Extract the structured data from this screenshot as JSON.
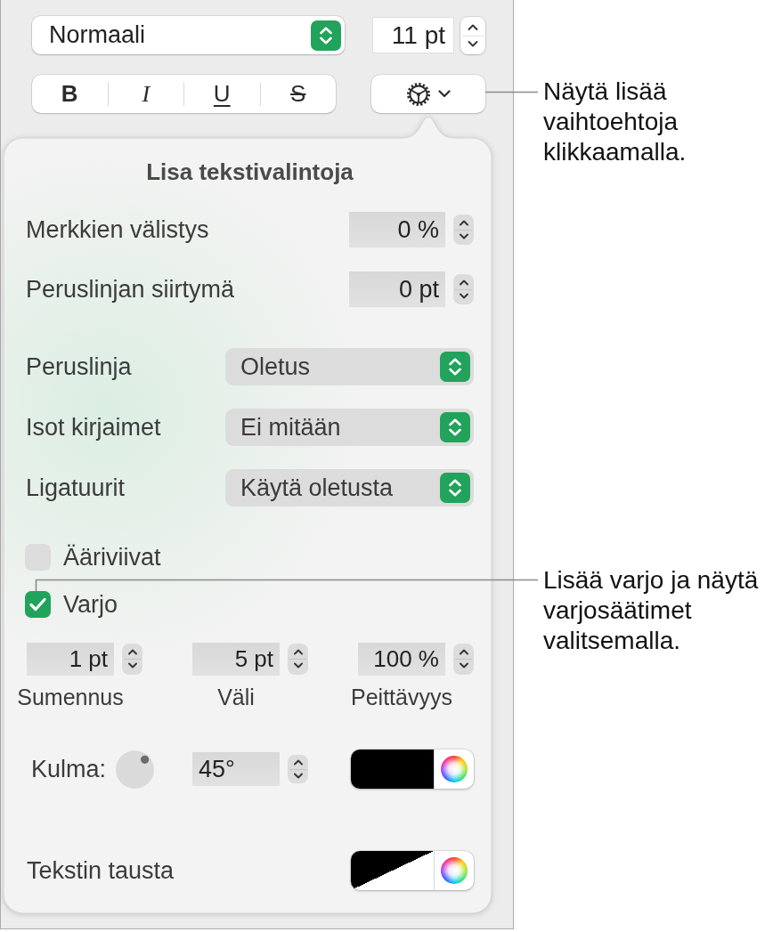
{
  "toolbar": {
    "paragraph_style": "Normaali",
    "font_size": "11 pt",
    "style_buttons": [
      {
        "label": "B",
        "kind": "bold",
        "on": false
      },
      {
        "label": "I",
        "kind": "italic",
        "on": false
      },
      {
        "label": "U",
        "kind": "underline",
        "on": false
      },
      {
        "label": "S",
        "kind": "strikethrough",
        "on": false
      }
    ]
  },
  "popover": {
    "title": "Lisa tekstivalintoja",
    "number_rows": [
      {
        "label": "Merkkien välistys",
        "value": "0 %"
      },
      {
        "label": "Peruslinjan siirtymä",
        "value": "0 pt"
      }
    ],
    "popup_rows": [
      {
        "label": "Peruslinja",
        "value": "Oletus"
      },
      {
        "label": "Isot kirjaimet",
        "value": "Ei mitään"
      },
      {
        "label": "Ligatuurit",
        "value": "Käytä oletusta"
      }
    ],
    "checkboxes": [
      {
        "label": "Ääriviivat",
        "checked": false
      },
      {
        "label": "Varjo",
        "checked": true
      }
    ],
    "shadow_fields": [
      {
        "value": "1 pt",
        "label": "Sumennus"
      },
      {
        "value": "5 pt",
        "label": "Väli"
      },
      {
        "value": "100 %",
        "label": "Peittävyys"
      }
    ],
    "angle": {
      "label": "Kulma:",
      "value": "45°"
    },
    "shadow_color": {
      "kind": "solid",
      "color": "#000000"
    },
    "text_background": {
      "label": "Tekstin tausta",
      "kind": "split"
    }
  },
  "callouts": [
    "Näytä lisää vaihtoehtoja klikkaamalla.",
    "Lisää varjo ja näytä varjosäätimet valitsemalla."
  ]
}
